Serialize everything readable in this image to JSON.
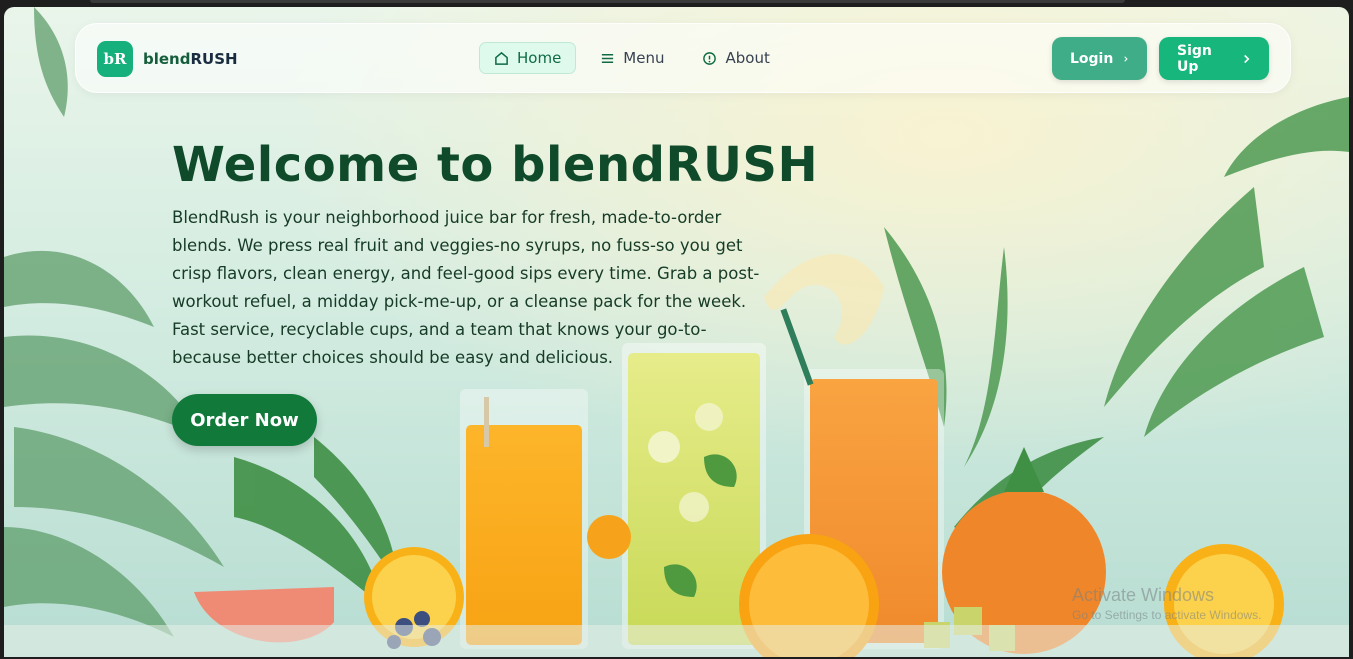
{
  "brand": {
    "badge": "bR",
    "name_part1": "blend",
    "name_part2": "RUSH"
  },
  "nav": {
    "items": [
      {
        "label": "Home",
        "icon": "home-icon",
        "active": true
      },
      {
        "label": "Menu",
        "icon": "menu-icon",
        "active": false
      },
      {
        "label": "About",
        "icon": "info-icon",
        "active": false
      }
    ]
  },
  "auth": {
    "login_label": "Login",
    "signup_label": "Sign Up"
  },
  "hero": {
    "title": "Welcome to blendRUSH",
    "description": "BlendRush is your neighborhood juice bar for fresh, made-to-order blends. We press real fruit and veggies-no syrups, no fuss-so you get crisp flavors, clean energy, and feel-good sips every time. Grab a post-workout refuel, a midday pick-me-up, or a cleanse pack for the week. Fast service, recyclable cups, and a team that knows your go-to-because better choices should be easy and delicious.",
    "cta_label": "Order Now"
  },
  "watermark": {
    "line1": "Activate Windows",
    "line2": "Go to Settings to activate Windows."
  },
  "colors": {
    "accent": "#16b67c",
    "cta": "#117a3b",
    "title": "#0f4a2b"
  }
}
